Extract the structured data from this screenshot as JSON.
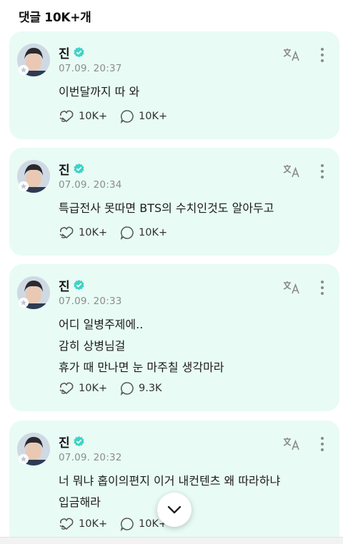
{
  "header": {
    "title": "댓글 10K+개"
  },
  "comments": [
    {
      "author": "진",
      "time": "07.09. 20:37",
      "lines": [
        "이번달까지 따 와"
      ],
      "likes": "10K+",
      "replies": "10K+"
    },
    {
      "author": "진",
      "time": "07.09. 20:34",
      "lines": [
        "특급전사 못따면 BTS의 수치인것도 알아두고"
      ],
      "likes": "10K+",
      "replies": "10K+"
    },
    {
      "author": "진",
      "time": "07.09. 20:33",
      "lines": [
        "어디 일병주제에..",
        "감히 상병님걸",
        "휴가 때 만나면 눈 마주칠 생각마라"
      ],
      "likes": "10K+",
      "replies": "9.3K"
    },
    {
      "author": "진",
      "time": "07.09. 20:32",
      "lines": [
        "너 뭐냐 홉이의편지 이거 내컨텐츠 왜 따라하냐",
        "입금해라"
      ],
      "likes": "10K+",
      "replies": "10K+"
    }
  ],
  "colors": {
    "card": "#e8fbf4",
    "verified": "#3fd2c7",
    "time": "#8c8c8c"
  },
  "icons": [
    "translate-icon",
    "more-icon",
    "verified-icon",
    "like-icon",
    "reply-icon",
    "chevron-down-icon"
  ]
}
